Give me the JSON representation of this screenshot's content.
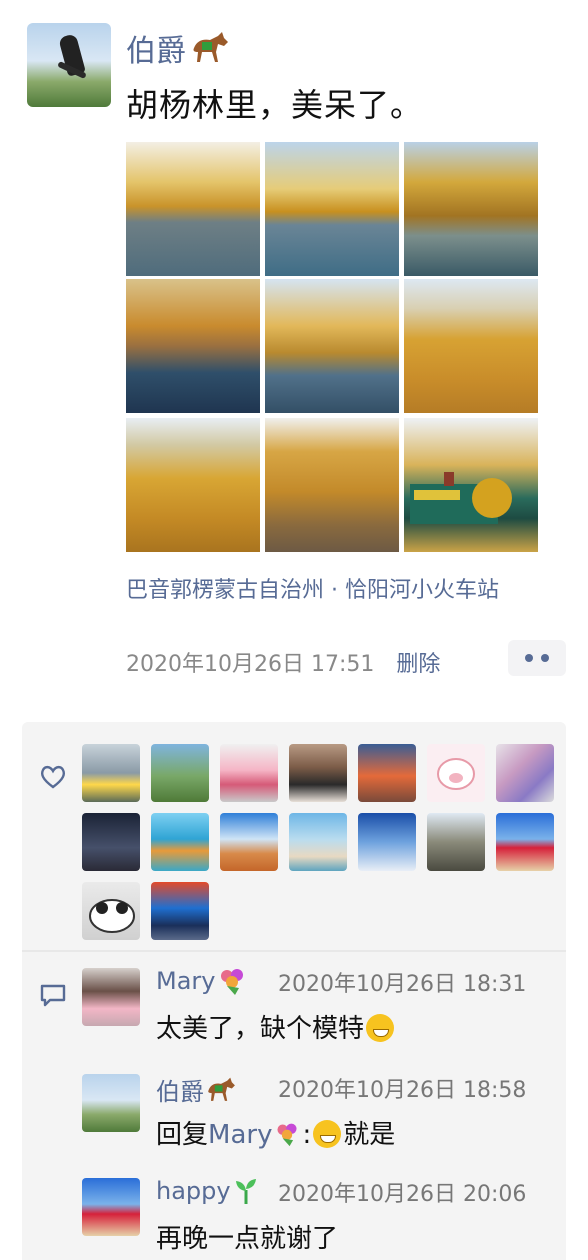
{
  "post": {
    "author": "伯爵",
    "text": "胡杨林里，美呆了。",
    "location": "巴音郭楞蒙古自治州 · 恰阳河小火车站",
    "timestamp": "2020年10月26日 17:51",
    "delete_label": "删除"
  },
  "comments": [
    {
      "name": "Mary",
      "time": "2020年10月26日 18:31",
      "text": "太美了，缺个模特"
    },
    {
      "name": "伯爵",
      "time": "2020年10月26日 18:58",
      "reply_prefix": "回复",
      "reply_to": "Mary",
      "reply_colon": ":",
      "text_after": "就是"
    },
    {
      "name": "happy",
      "time": "2020年10月26日 20:06",
      "text": "再晚一点就谢了"
    }
  ],
  "colors": {
    "link": "#576b95",
    "panel": "#f4f4f4"
  }
}
